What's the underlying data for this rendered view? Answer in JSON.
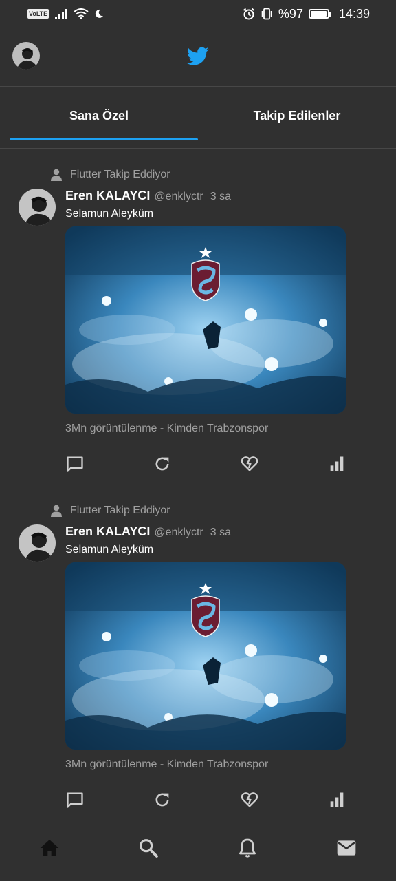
{
  "status_bar": {
    "volte": "VoLTE",
    "battery_percent": "%97",
    "battery_level": 0.97,
    "time": "14:39",
    "icons": [
      "signal-icon",
      "wifi-icon",
      "moon-icon",
      "alarm-icon",
      "vibrate-icon",
      "battery-icon"
    ]
  },
  "app_bar": {
    "logo": "twitter-bird-icon",
    "brand_color": "#1da1f2"
  },
  "tabs": [
    {
      "label": "Sana Özel",
      "active": true
    },
    {
      "label": "Takip Edilenler",
      "active": false
    }
  ],
  "tweets": [
    {
      "retweet_label": "Flutter Takip Eddiyor",
      "author_name": "Eren KALAYCI",
      "author_handle": "@enklyctr",
      "time": "3 sa",
      "text": "Selamun Aleyküm",
      "views_text": "3Mn görüntülenme - Kimden Trabzonspor",
      "actions": [
        "comment-icon",
        "retweet-icon",
        "like-icon",
        "stats-icon"
      ]
    },
    {
      "retweet_label": "Flutter Takip Eddiyor",
      "author_name": "Eren KALAYCI",
      "author_handle": "@enklyctr",
      "time": "3 sa",
      "text": "Selamun Aleyküm",
      "views_text": "3Mn görüntülenme - Kimden Trabzonspor",
      "actions": [
        "comment-icon",
        "retweet-icon",
        "like-icon",
        "stats-icon"
      ]
    }
  ],
  "bottom_nav": [
    "home-icon",
    "search-icon",
    "notifications-icon",
    "messages-icon"
  ],
  "colors": {
    "background": "#303030",
    "divider": "#474747",
    "secondary_text": "#a0a0a0",
    "accent": "#1da1f2"
  }
}
